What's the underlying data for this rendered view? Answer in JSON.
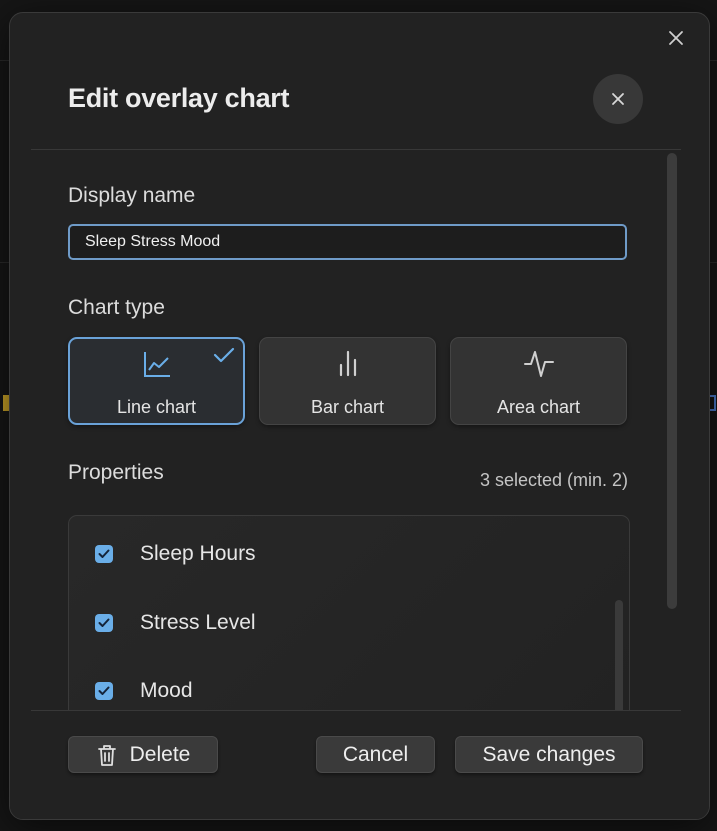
{
  "dialog": {
    "title": "Edit overlay chart",
    "display_name_label": "Display name",
    "display_name_value": "Sleep Stress Mood",
    "chart_type_label": "Chart type",
    "chart_types": [
      {
        "label": "Line chart",
        "icon": "line-chart-icon",
        "selected": true
      },
      {
        "label": "Bar chart",
        "icon": "bar-chart-icon",
        "selected": false
      },
      {
        "label": "Area chart",
        "icon": "area-chart-icon",
        "selected": false
      }
    ],
    "properties_label": "Properties",
    "properties_count": "3 selected (min. 2)",
    "properties": [
      {
        "label": "Sleep Hours",
        "checked": true
      },
      {
        "label": "Stress Level",
        "checked": true
      },
      {
        "label": "Mood",
        "checked": true
      }
    ]
  },
  "footer": {
    "delete_label": "Delete",
    "cancel_label": "Cancel",
    "save_label": "Save changes"
  },
  "colors": {
    "accent": "#6aaee8",
    "modal_bg": "#222222",
    "card_bg": "#333333"
  }
}
